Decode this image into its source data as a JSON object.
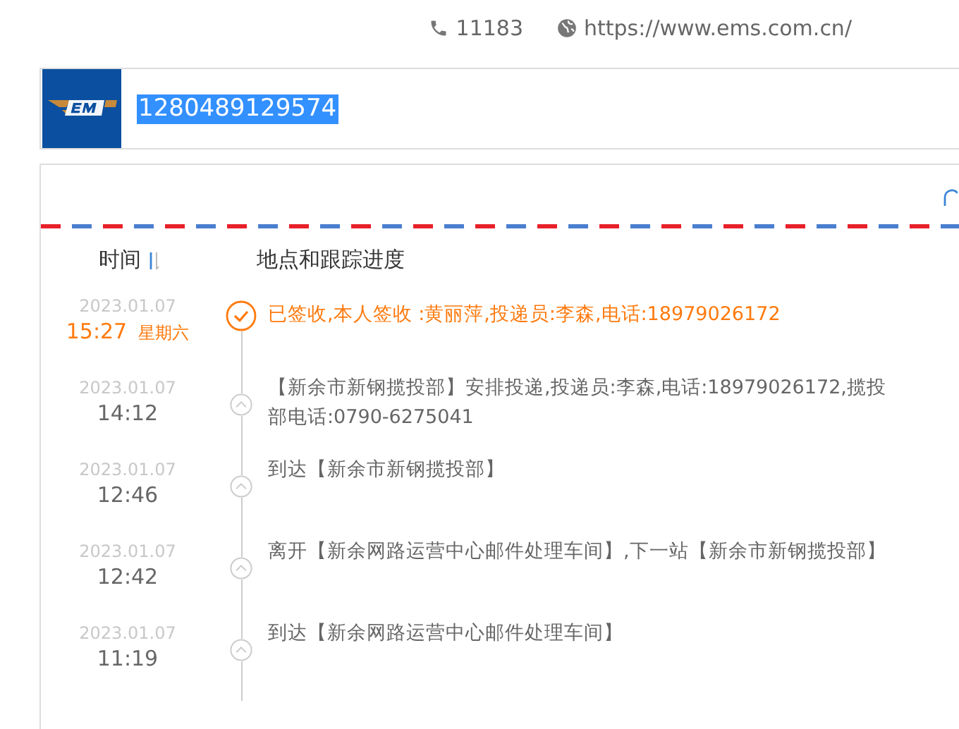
{
  "contact": {
    "phone": "11183",
    "website": "https://www.ems.com.cn/"
  },
  "search": {
    "value": "1280489129574",
    "selected": true
  },
  "table": {
    "columns": [
      {
        "label": "时间"
      },
      {
        "label": "地点和跟踪进度"
      }
    ],
    "events": [
      {
        "kind": "delivered",
        "date": "2023.01.07",
        "time": "15:27",
        "weekday": "星期六",
        "text": "已签收,本人签收 :黄丽萍,投递员:李森,电话:18979026172"
      },
      {
        "kind": "transit",
        "date": "2023.01.07",
        "time": "14:12",
        "text": "【新余市新钢揽投部】安排投递,投递员:李森,电话:18979026172,揽投部电话:0790-6275041"
      },
      {
        "kind": "transit",
        "date": "2023.01.07",
        "time": "12:46",
        "text": "到达【新余市新钢揽投部】"
      },
      {
        "kind": "transit",
        "date": "2023.01.07",
        "time": "12:42",
        "text": "离开【新余网路运营中心邮件处理车间】,下一站【新余市新钢揽投部】"
      },
      {
        "kind": "transit",
        "date": "2023.01.07",
        "time": "11:19",
        "text": "到达【新余网路运营中心邮件处理车间】"
      }
    ]
  }
}
